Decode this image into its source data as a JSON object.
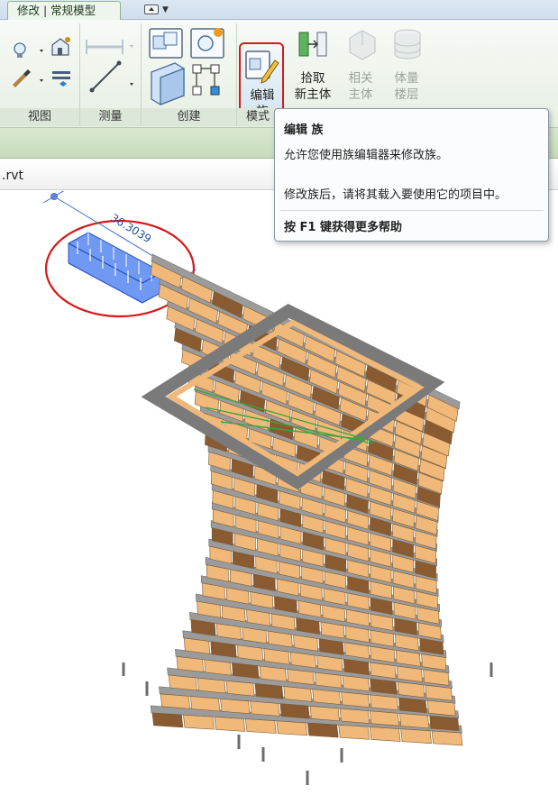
{
  "ribbon": {
    "active_tab": "修改 | 常规模型",
    "panels": {
      "view": "视图",
      "measure": "测量",
      "create": "创建",
      "mode": "模式"
    },
    "buttons": {
      "edit_family_line1": "编辑",
      "edit_family_line2": "族",
      "pick_host_line1": "拾取",
      "pick_host_line2": "新主体",
      "related_host_line1": "相关",
      "related_host_line2": "主体",
      "mass_floors_line1": "体量",
      "mass_floors_line2": "楼层"
    }
  },
  "tooltip": {
    "title": "编辑 族",
    "line1": "允许您使用族编辑器来修改族。",
    "line2": "修改族后，请将其载入要使用它的项目中。",
    "help": "按 F1 键获得更多帮助"
  },
  "view": {
    "tab_title": ".rvt"
  },
  "canvas": {
    "dimension": "36.3039"
  },
  "colors": {
    "selection_red": "#d51a1a",
    "panel_face": "#f0b97a",
    "slab_gray": "#9b9b9b",
    "family_blue": "#4a7df0"
  },
  "icons": [
    "lightbulb-icon",
    "paintbrush-icon",
    "house-settings-icon",
    "layers-icon",
    "align-dimension-icon",
    "measure-icon",
    "create-family-icon",
    "create-similar-icon",
    "create-parts-icon",
    "create-group-icon",
    "edit-family-icon",
    "pick-host-icon",
    "related-host-icon",
    "mass-floors-icon",
    "mouse-cursor-icon"
  ]
}
